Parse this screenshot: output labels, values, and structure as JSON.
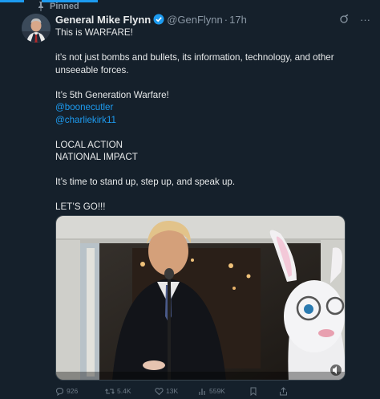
{
  "pinned_label": "Pinned",
  "tweet": {
    "display_name": "General Mike Flynn",
    "handle": "@GenFlynn",
    "time": "17h",
    "lines": {
      "l1": "This is WARFARE!",
      "l2": "it’s not just bombs and bullets, its information, technology, and other unseeable forces.",
      "l3": "It’s 5th Generation Warfare!",
      "m1": "@boonecutler",
      "m2": "@charliekirk11",
      "l4": "LOCAL ACTION",
      "l5": "NATIONAL IMPACT",
      "l6": "It’s time to stand up, step up, and speak up.",
      "l7": "LET’S GO!!!"
    },
    "counts": {
      "replies": "926",
      "reposts": "5.4K",
      "likes": "13K",
      "views": "559K"
    }
  },
  "colors": {
    "background": "#15202b",
    "text": "#e7e9ea",
    "secondary": "#8b98a5",
    "accent": "#1d9bf0"
  },
  "icons": [
    "pin-icon",
    "verified-icon",
    "grok-icon",
    "more-icon",
    "reply-icon",
    "repost-icon",
    "like-icon",
    "views-icon",
    "bookmark-icon",
    "share-icon",
    "mute-icon"
  ]
}
